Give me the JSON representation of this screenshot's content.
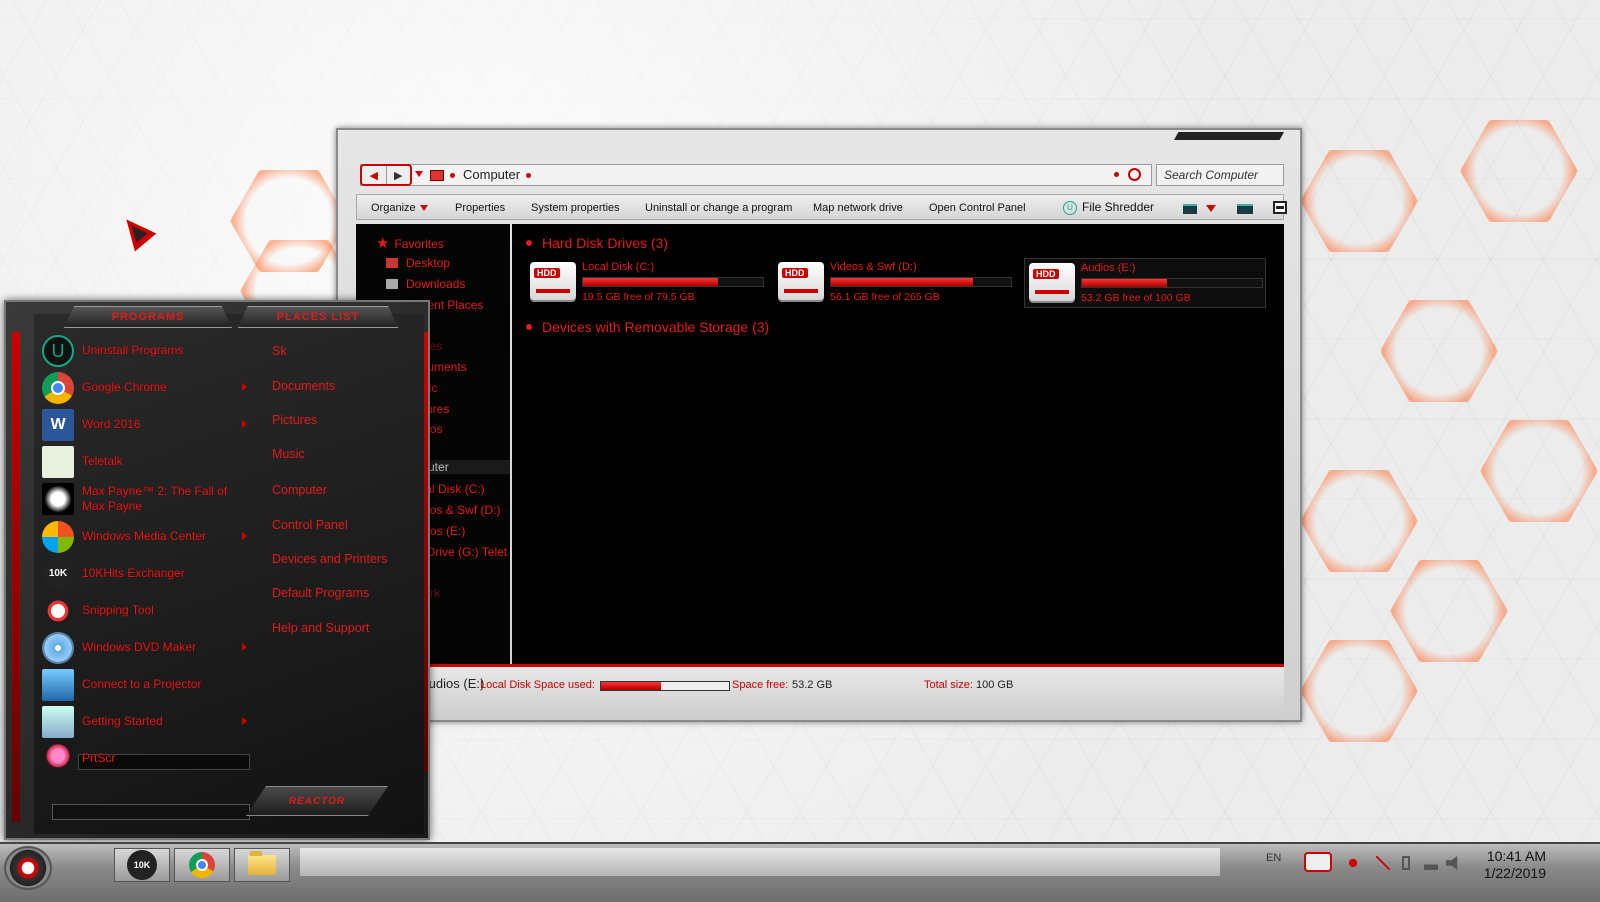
{
  "explorer": {
    "address": "Computer",
    "search_placeholder": "Search Computer",
    "toolbar": {
      "organize": "Organize",
      "properties": "Properties",
      "system_properties": "System properties",
      "uninstall": "Uninstall or change a program",
      "map_drive": "Map network drive",
      "control_panel": "Open Control Panel",
      "file_shredder": "File Shredder"
    },
    "nav": {
      "favorites": "Favorites",
      "desktop": "Desktop",
      "downloads": "Downloads",
      "recent": "Recent Places",
      "libraries": "Libraries",
      "documents": "Documents",
      "music": "Music",
      "pictures": "Pictures",
      "videos": "Videos",
      "computer": "Computer",
      "local_disk": "Local Disk (C:)",
      "videos_swf": "Videos & Swf (D:)",
      "audios": "Audios (E:)",
      "drive_g": "CD Drive (G:) Telet",
      "network": "Network"
    },
    "sections": {
      "hdd": "Hard Disk Drives (3)",
      "removable": "Devices with Removable Storage (3)"
    },
    "drives": [
      {
        "name": "Local Disk (C:)",
        "free": "19.5 GB free of 79.5 GB",
        "used_fraction": 0.75
      },
      {
        "name": "Videos & Swf (D:)",
        "free": "56.1 GB free of 265 GB",
        "used_fraction": 0.79
      },
      {
        "name": "Audios (E:)",
        "free": "53.2 GB free of 100 GB",
        "used_fraction": 0.47
      }
    ],
    "details": {
      "name": "Audios (E:)",
      "type_label": "Local Disk Space used:",
      "used_fraction": 0.47,
      "free_label": "Space free:",
      "free_value": "53.2 GB",
      "total_label": "Total size:",
      "total_value": "100 GB"
    }
  },
  "start_menu": {
    "programs_header": "PROGRAMS",
    "places_header": "PLACES LIST",
    "programs": [
      {
        "label": "Uninstall Programs",
        "icon": "uninstall-icon",
        "arrow": false
      },
      {
        "label": "Google Chrome",
        "icon": "chrome-icon",
        "arrow": true
      },
      {
        "label": "Word 2016",
        "icon": "word-icon",
        "arrow": true
      },
      {
        "label": "Teletalk",
        "icon": "teletalk-icon",
        "arrow": false
      },
      {
        "label": "Max Payne™ 2: The Fall of Max Payne",
        "icon": "max-payne-icon",
        "arrow": false
      },
      {
        "label": "Windows Media Center",
        "icon": "media-center-icon",
        "arrow": true
      },
      {
        "label": "10KHits Exchanger",
        "icon": "10khits-icon",
        "arrow": false
      },
      {
        "label": "Snipping Tool",
        "icon": "scissors-icon",
        "arrow": false
      },
      {
        "label": "Windows DVD Maker",
        "icon": "dvd-icon",
        "arrow": true
      },
      {
        "label": "Connect to a Projector",
        "icon": "projector-icon",
        "arrow": false
      },
      {
        "label": "Getting Started",
        "icon": "getting-started-icon",
        "arrow": true
      },
      {
        "label": "PrtScr",
        "icon": "user-icon",
        "arrow": false
      }
    ],
    "places": [
      "Sk",
      "Documents",
      "Pictures",
      "Music",
      "Computer",
      "Control Panel",
      "Devices and Printers",
      "Default Programs",
      "Help and Support"
    ],
    "power_label": "REACTOR"
  },
  "taskbar": {
    "lang": "EN",
    "time": "10:41 AM",
    "date": "1/22/2019",
    "tenk_label": "10K"
  },
  "colors": {
    "accent": "#e21b1b",
    "panel": "#000000"
  }
}
